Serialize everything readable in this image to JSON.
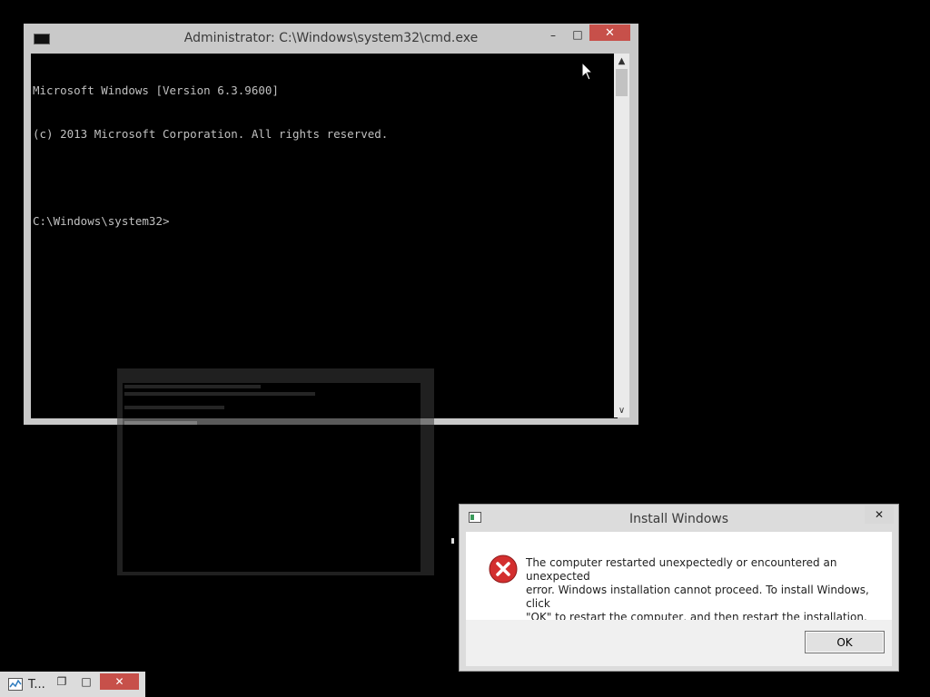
{
  "cmd_window": {
    "title": "Administrator: C:\\Windows\\system32\\cmd.exe",
    "icon": "cmd-icon",
    "minimize_glyph": "–",
    "maximize_glyph": "□",
    "close_glyph": "✕",
    "lines": [
      "Microsoft Windows [Version 6.3.9600]",
      "(c) 2013 Microsoft Corporation. All rights reserved.",
      "",
      "C:\\Windows\\system32>"
    ],
    "scroll_up": "▲",
    "scroll_down": "∨"
  },
  "dialog": {
    "title": "Install Windows",
    "icon": "setup-icon",
    "close_glyph": "✕",
    "error_icon": "error-icon",
    "message": "The computer restarted unexpectedly or encountered an unexpected\nerror. Windows installation cannot proceed. To install Windows, click\n\"OK\" to restart the computer, and then restart the installation.",
    "ok_label": "OK"
  },
  "taskbar_item": {
    "label": "T...",
    "icon": "task-manager-icon",
    "restore_glyph": "❐",
    "maximize_glyph": "□",
    "close_glyph": "✕"
  },
  "colors": {
    "desktop": "#000000",
    "window_frame": "#c9c9c9",
    "close_button": "#c7504a",
    "error_red": "#d32f2f"
  }
}
